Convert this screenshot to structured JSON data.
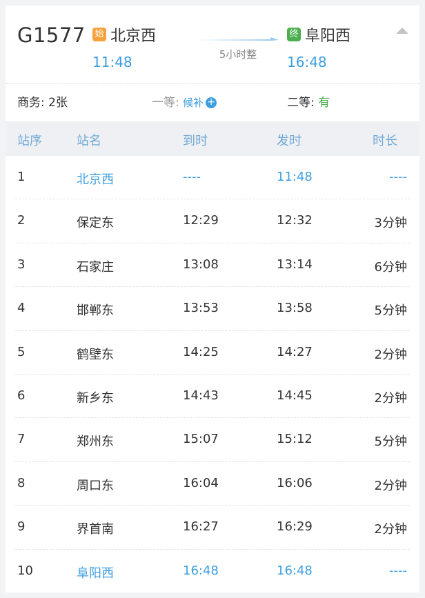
{
  "train": {
    "number": "G1577",
    "from": {
      "badge": "始",
      "name": "北京西",
      "time": "11:48"
    },
    "to": {
      "badge": "终",
      "name": "阜阳西",
      "time": "16:48"
    },
    "duration": "5小时整"
  },
  "seats": {
    "business": {
      "label": "商务:",
      "value": "2张"
    },
    "first": {
      "label": "一等:",
      "value": "候补",
      "icon": "plus-circle-icon"
    },
    "second": {
      "label": "二等:",
      "value": "有"
    }
  },
  "table": {
    "headers": {
      "seq": "站序",
      "name": "站名",
      "arrive": "到时",
      "depart": "发时",
      "stop": "时长"
    },
    "rows": [
      {
        "seq": "1",
        "name": "北京西",
        "arrive": "----",
        "depart": "11:48",
        "stop": "----",
        "highlight": true
      },
      {
        "seq": "2",
        "name": "保定东",
        "arrive": "12:29",
        "depart": "12:32",
        "stop": "3分钟",
        "highlight": false
      },
      {
        "seq": "3",
        "name": "石家庄",
        "arrive": "13:08",
        "depart": "13:14",
        "stop": "6分钟",
        "highlight": false
      },
      {
        "seq": "4",
        "name": "邯郸东",
        "arrive": "13:53",
        "depart": "13:58",
        "stop": "5分钟",
        "highlight": false
      },
      {
        "seq": "5",
        "name": "鹤壁东",
        "arrive": "14:25",
        "depart": "14:27",
        "stop": "2分钟",
        "highlight": false
      },
      {
        "seq": "6",
        "name": "新乡东",
        "arrive": "14:43",
        "depart": "14:45",
        "stop": "2分钟",
        "highlight": false
      },
      {
        "seq": "7",
        "name": "郑州东",
        "arrive": "15:07",
        "depart": "15:12",
        "stop": "5分钟",
        "highlight": false
      },
      {
        "seq": "8",
        "name": "周口东",
        "arrive": "16:04",
        "depart": "16:06",
        "stop": "2分钟",
        "highlight": false
      },
      {
        "seq": "9",
        "name": "界首南",
        "arrive": "16:27",
        "depart": "16:29",
        "stop": "2分钟",
        "highlight": false
      },
      {
        "seq": "10",
        "name": "阜阳西",
        "arrive": "16:48",
        "depart": "16:48",
        "stop": "----",
        "highlight": true
      }
    ]
  },
  "colors": {
    "accent": "#3d9ee0",
    "start_badge": "#f6a13a",
    "end_badge": "#4cb050",
    "available": "#4cb050"
  }
}
